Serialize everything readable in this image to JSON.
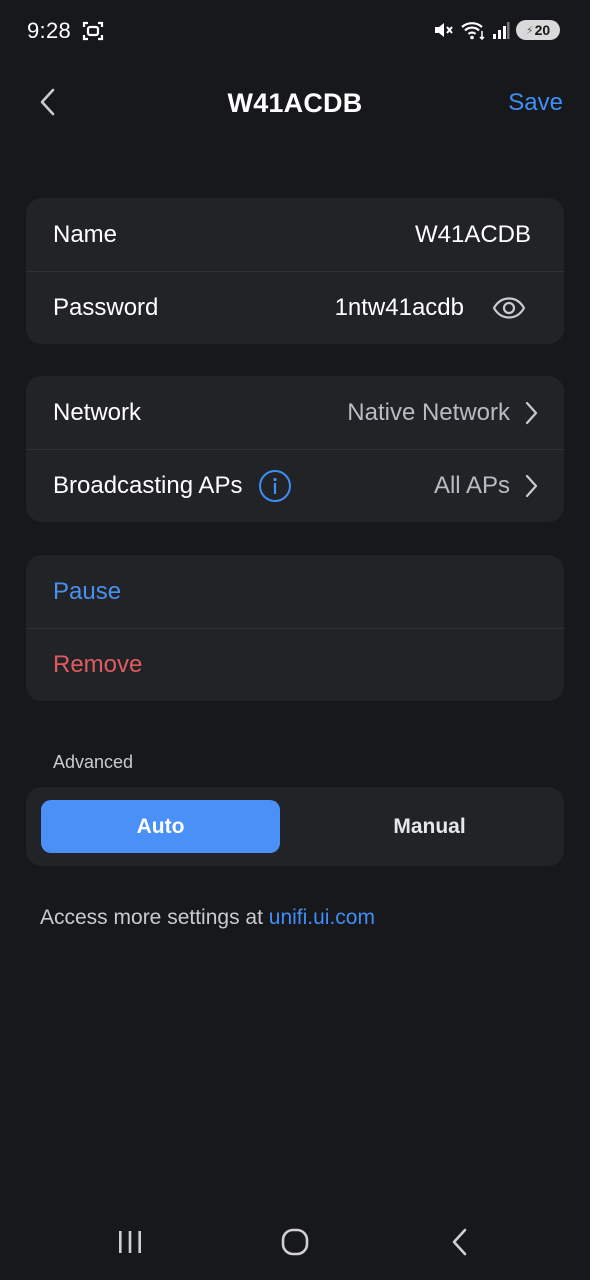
{
  "status_bar": {
    "time": "9:28",
    "battery": "20",
    "icons": [
      "screenshot-icon",
      "mute-icon",
      "wifi-icon",
      "signal-icon",
      "battery-icon"
    ]
  },
  "header": {
    "title": "W41ACDB",
    "save_label": "Save",
    "back_icon": "chevron-left-icon"
  },
  "credentials": {
    "name_label": "Name",
    "name_value": "W41ACDB",
    "password_label": "Password",
    "password_value": "1ntw41acdb",
    "eye_icon": "eye-icon"
  },
  "network": {
    "network_label": "Network",
    "network_value": "Native Network",
    "broadcasting_label": "Broadcasting APs",
    "broadcasting_value": "All APs",
    "info_icon": "info-icon"
  },
  "actions": {
    "pause_label": "Pause",
    "remove_label": "Remove"
  },
  "advanced": {
    "label": "Advanced",
    "options": [
      "Auto",
      "Manual"
    ],
    "selected": "Auto"
  },
  "footer": {
    "prefix": "Access more settings at ",
    "link": "unifi.ui.com"
  },
  "colors": {
    "background": "#17181b",
    "card": "#222327",
    "accent": "#3f8ef7",
    "danger": "#e05b5f"
  }
}
